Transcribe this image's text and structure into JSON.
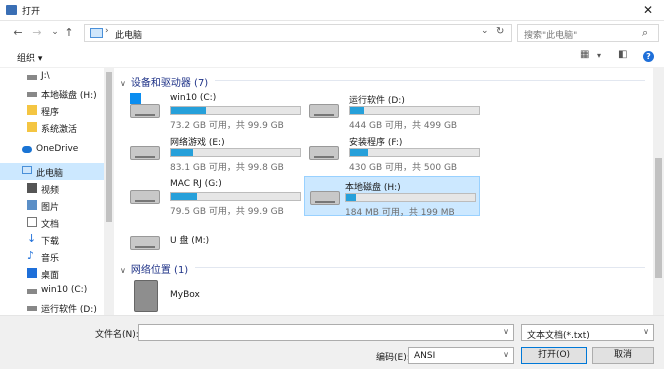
{
  "window": {
    "title": "打开",
    "close_glyph": "✕"
  },
  "nav": {
    "back": "←",
    "forward": "→",
    "recent": "⌄",
    "up": "↑"
  },
  "address": {
    "path": "此电脑",
    "separator": "›",
    "dropdown": "⌄",
    "refresh": "↻"
  },
  "search": {
    "placeholder": "搜索\"此电脑\"",
    "icon": "search-icon"
  },
  "toolbar": {
    "organize_label": "组织 ▾"
  },
  "sidebar": {
    "items": [
      {
        "label": "J:\\",
        "icon": "drive-icon"
      },
      {
        "label": "本地磁盘 (H:)",
        "icon": "drive-icon"
      },
      {
        "label": "程序",
        "icon": "folder-icon"
      },
      {
        "label": "系统激活",
        "icon": "folder-icon"
      },
      {
        "label": "OneDrive",
        "icon": "cloud-icon"
      },
      {
        "label": "此电脑",
        "icon": "computer-icon",
        "selected": true
      },
      {
        "label": "视频",
        "icon": "video-icon"
      },
      {
        "label": "图片",
        "icon": "picture-icon"
      },
      {
        "label": "文档",
        "icon": "document-icon"
      },
      {
        "label": "下载",
        "icon": "download-icon"
      },
      {
        "label": "音乐",
        "icon": "music-icon"
      },
      {
        "label": "桌面",
        "icon": "desktop-icon"
      },
      {
        "label": "win10 (C:)",
        "icon": "drive-icon"
      },
      {
        "label": "运行软件 (D:)",
        "icon": "drive-icon"
      }
    ]
  },
  "groups": {
    "devices": "设备和驱动器 (7)",
    "network": "网络位置 (1)"
  },
  "drives": [
    {
      "name": "win10 (C:)",
      "info": "73.2 GB 可用，共 99.9 GB",
      "used_fraction": 0.27,
      "system": true
    },
    {
      "name": "运行软件 (D:)",
      "info": "444 GB 可用，共 499 GB",
      "used_fraction": 0.11
    },
    {
      "name": "网络游戏 (E:)",
      "info": "83.1 GB 可用，共 99.8 GB",
      "used_fraction": 0.17
    },
    {
      "name": "安装程序 (F:)",
      "info": "430 GB 可用，共 500 GB",
      "used_fraction": 0.14
    },
    {
      "name": "MAC RJ (G:)",
      "info": "79.5 GB 可用，共 99.9 GB",
      "used_fraction": 0.2
    },
    {
      "name": "本地磁盘 (H:)",
      "info": "184 MB 可用，共 199 MB",
      "used_fraction": 0.08,
      "selected": true
    },
    {
      "name": "U 盘 (M:)",
      "info": "",
      "used_fraction": null
    }
  ],
  "network_items": [
    {
      "name": "MyBox"
    }
  ],
  "bottom": {
    "filename_label": "文件名(N):",
    "filename_value": "",
    "filetype_value": "文本文档(*.txt)",
    "encoding_label": "编码(E):",
    "encoding_value": "ANSI",
    "open_label": "打开(O)",
    "cancel_label": "取消"
  }
}
